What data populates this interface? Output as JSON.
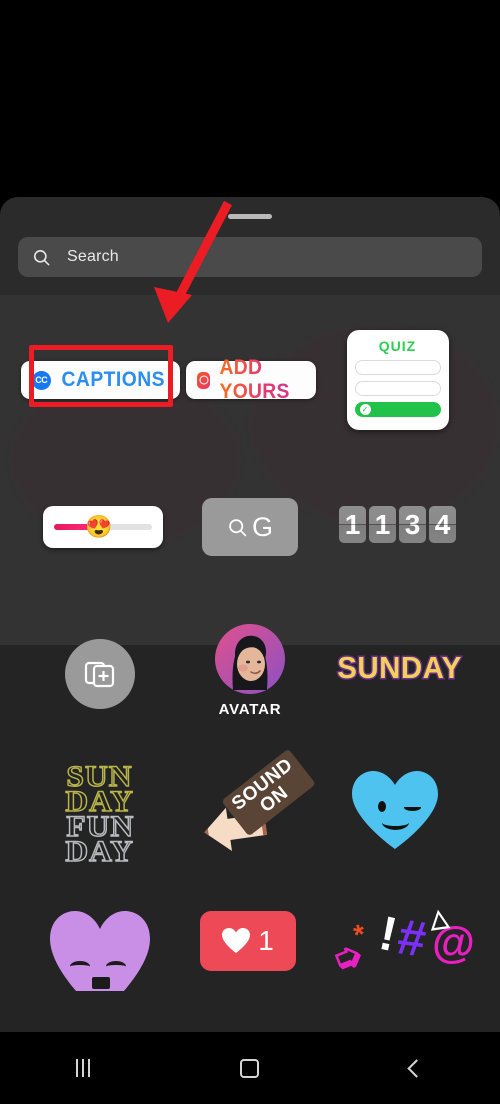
{
  "app": {
    "screen_name": "Instagram Story Sticker Tray",
    "background_color": "#000000",
    "sheet_color": "#2b2b2b"
  },
  "search": {
    "placeholder": "Search",
    "icon": "search-icon"
  },
  "annotation": {
    "color": "#ec1c24",
    "arrow": "arrow-pointing-down-left",
    "highlight_target": "CAPTIONS"
  },
  "stickers": {
    "row1": [
      {
        "id": "captions",
        "label": "CAPTIONS",
        "badge": "CC",
        "badge_color": "#1877f2",
        "text_color": "#2b8ef0",
        "highlighted": true
      },
      {
        "id": "add-yours",
        "label": "ADD YOURS",
        "badge": "camera-icon",
        "gradient_from": "#f7701d",
        "gradient_to": "#c9379c"
      },
      {
        "id": "quiz",
        "label": "QUIZ",
        "title_color": "#2ecc50",
        "option_rows": 3,
        "correct_row": 3,
        "fill_color": "#21c24a"
      }
    ],
    "row2": [
      {
        "id": "emoji-slider",
        "emoji": "😍",
        "fill_percent": 48,
        "fill_color": "#e8175d"
      },
      {
        "id": "gif-search",
        "label": "G",
        "icon": "search-icon",
        "background": "#9a9a9a"
      },
      {
        "id": "countdown",
        "digits": [
          "1",
          "1",
          "3",
          "4"
        ]
      }
    ],
    "row3": [
      {
        "id": "add-photo",
        "icon": "add-photo-icon"
      },
      {
        "id": "avatar",
        "label": "AVATAR",
        "ring_from": "#e0518c",
        "ring_to": "#8c51c4"
      },
      {
        "id": "sunday",
        "label": "SUNDAY",
        "text_color": "#f2d05a",
        "outline_color": "#6b2f8c"
      }
    ],
    "row4": [
      {
        "id": "sunday-fun-day",
        "lines": [
          "SUN",
          "DAY",
          "FUN",
          "DAY"
        ],
        "top_color": "#b9b54a",
        "bottom_color": "#b9bcc0"
      },
      {
        "id": "sound-on",
        "label": "SOUND ON",
        "line1": "SOUND",
        "line2": "ON"
      },
      {
        "id": "blue-heart-wink",
        "color": "#4ec3f0"
      }
    ],
    "row5": [
      {
        "id": "purple-heart-face",
        "color": "#c98ee6"
      },
      {
        "id": "like-counter",
        "count": "1",
        "icon": "heart-icon",
        "background": "#ed4956"
      },
      {
        "id": "symbols",
        "glyphs": [
          "*",
          "!",
          "#",
          "@"
        ]
      }
    ]
  },
  "navbar": {
    "recents": "recents-icon",
    "home": "home-icon",
    "back": "back-icon"
  }
}
